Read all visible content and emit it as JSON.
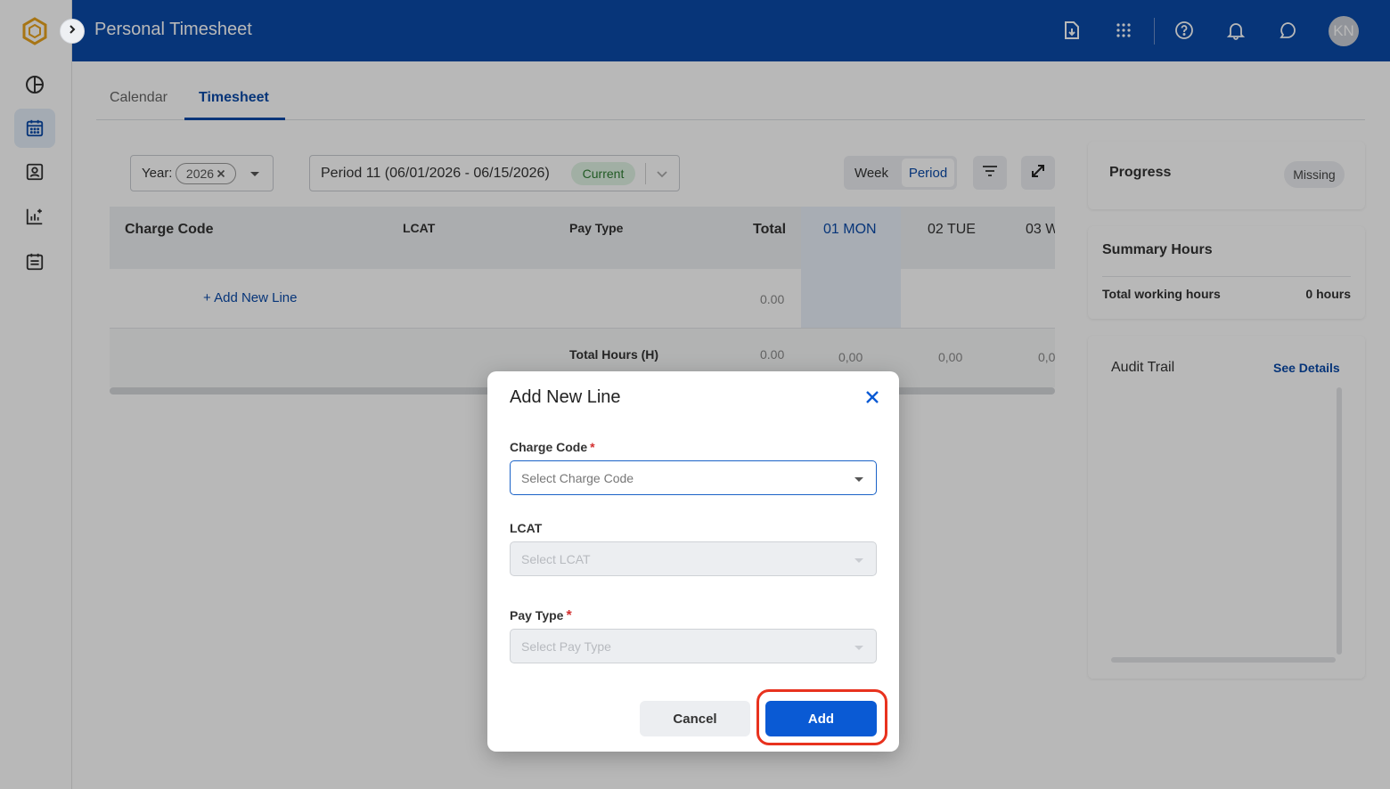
{
  "header": {
    "title": "Personal Timesheet",
    "avatar_initials": "KN",
    "icons": [
      "export-icon",
      "apps-grid-icon",
      "help-icon",
      "bell-icon",
      "chat-icon"
    ]
  },
  "sidebar": {
    "items": [
      {
        "icon": "dashboard-pie-icon"
      },
      {
        "icon": "calendar-icon",
        "active": true
      },
      {
        "icon": "profile-card-icon"
      },
      {
        "icon": "report-chart-icon"
      },
      {
        "icon": "schedule-icon"
      }
    ]
  },
  "tabs": [
    {
      "label": "Calendar"
    },
    {
      "label": "Timesheet",
      "active": true
    }
  ],
  "filters": {
    "year_label": "Year:",
    "year_value": "2026",
    "period_text": "Period 11 (06/01/2026 - 06/15/2026)",
    "period_badge": "Current",
    "view_toggle": {
      "week": "Week",
      "period": "Period",
      "selected": "Period"
    }
  },
  "table": {
    "columns": {
      "charge_code": "Charge Code",
      "lcat": "LCAT",
      "pay_type": "Pay Type",
      "total": "Total",
      "day1": "01 MON",
      "day2": "02 TUE",
      "day3": "03 W"
    },
    "add_line_label": "+ Add New Line",
    "add_line_total": "0.00",
    "total_hours_label": "Total Hours (H)",
    "total_hours_total": "0.00",
    "total_day1": "0,00",
    "total_day2": "0,00",
    "total_day3": "0,0"
  },
  "progress": {
    "title": "Progress",
    "status": "Missing"
  },
  "summary": {
    "title": "Summary Hours",
    "label": "Total working hours",
    "value": "0 hours"
  },
  "audit": {
    "title": "Audit Trail",
    "link": "See Details"
  },
  "modal": {
    "title": "Add New Line",
    "charge_code_label": "Charge Code",
    "charge_code_placeholder": "Select Charge Code",
    "lcat_label": "LCAT",
    "lcat_placeholder": "Select LCAT",
    "pay_type_label": "Pay Type",
    "pay_type_placeholder": "Select Pay Type",
    "required_mark": "*",
    "cancel_label": "Cancel",
    "add_label": "Add"
  },
  "colors": {
    "brand_blue": "#0a4aa8",
    "primary_button": "#0a5ad4",
    "highlight_ring": "#e8321e",
    "current_badge_bg": "#dff3e4",
    "current_badge_text": "#2e7d32"
  }
}
